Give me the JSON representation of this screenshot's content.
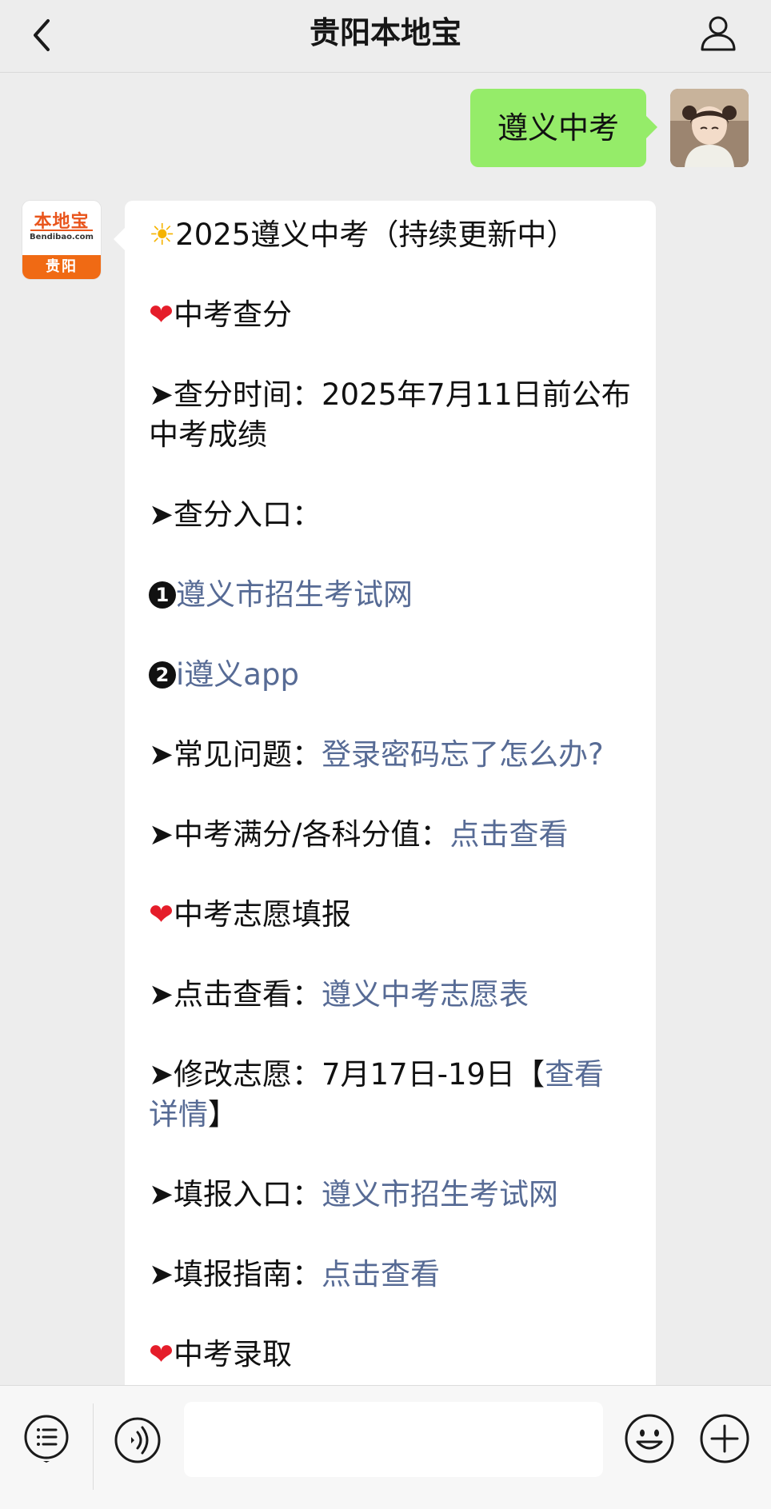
{
  "header": {
    "title": "贵阳本地宝"
  },
  "outgoing": {
    "text": "遵义中考"
  },
  "incoming": {
    "avatar": {
      "logo_text": "本地宝",
      "logo_domain": "Bendibao.com",
      "logo_city": "贵阳"
    },
    "lines": {
      "title_emoji": "☀",
      "title": "2025遵义中考（持续更新中）",
      "section1_emoji": "❤",
      "section1": "中考查分",
      "query_time_prefix": "➤查分时间：",
      "query_time_value": "2025年7月11日前公布中考成绩",
      "query_entry": "➤查分入口：",
      "entry1_num": "1",
      "entry1_link": "遵义市招生考试网",
      "entry2_num": "2",
      "entry2_link": "i遵义app",
      "faq_prefix": "➤常见问题：",
      "faq_link": "登录密码忘了怎么办?",
      "fullscore_prefix": "➤中考满分/各科分值：",
      "fullscore_link": "点击查看",
      "section2_emoji": "❤",
      "section2": "中考志愿填报",
      "view_prefix": "➤点击查看：",
      "view_link": "遵义中考志愿表",
      "modify_prefix": "➤修改志愿：7月17日-19日【",
      "modify_link": "查看详情",
      "modify_suffix": "】",
      "fill_entry_prefix": "➤填报入口：",
      "fill_entry_link": "遵义市招生考试网",
      "fill_guide_prefix": "➤填报指南：",
      "fill_guide_link": "点击查看",
      "section3_emoji": "❤",
      "section3": "中考录取"
    }
  },
  "icons": {
    "back": "chevron-left-icon",
    "profile": "user-icon",
    "menu": "list-icon",
    "voice": "voice-icon",
    "emoji": "smiley-icon",
    "plus": "plus-icon"
  },
  "input": {
    "value": "",
    "placeholder": ""
  }
}
